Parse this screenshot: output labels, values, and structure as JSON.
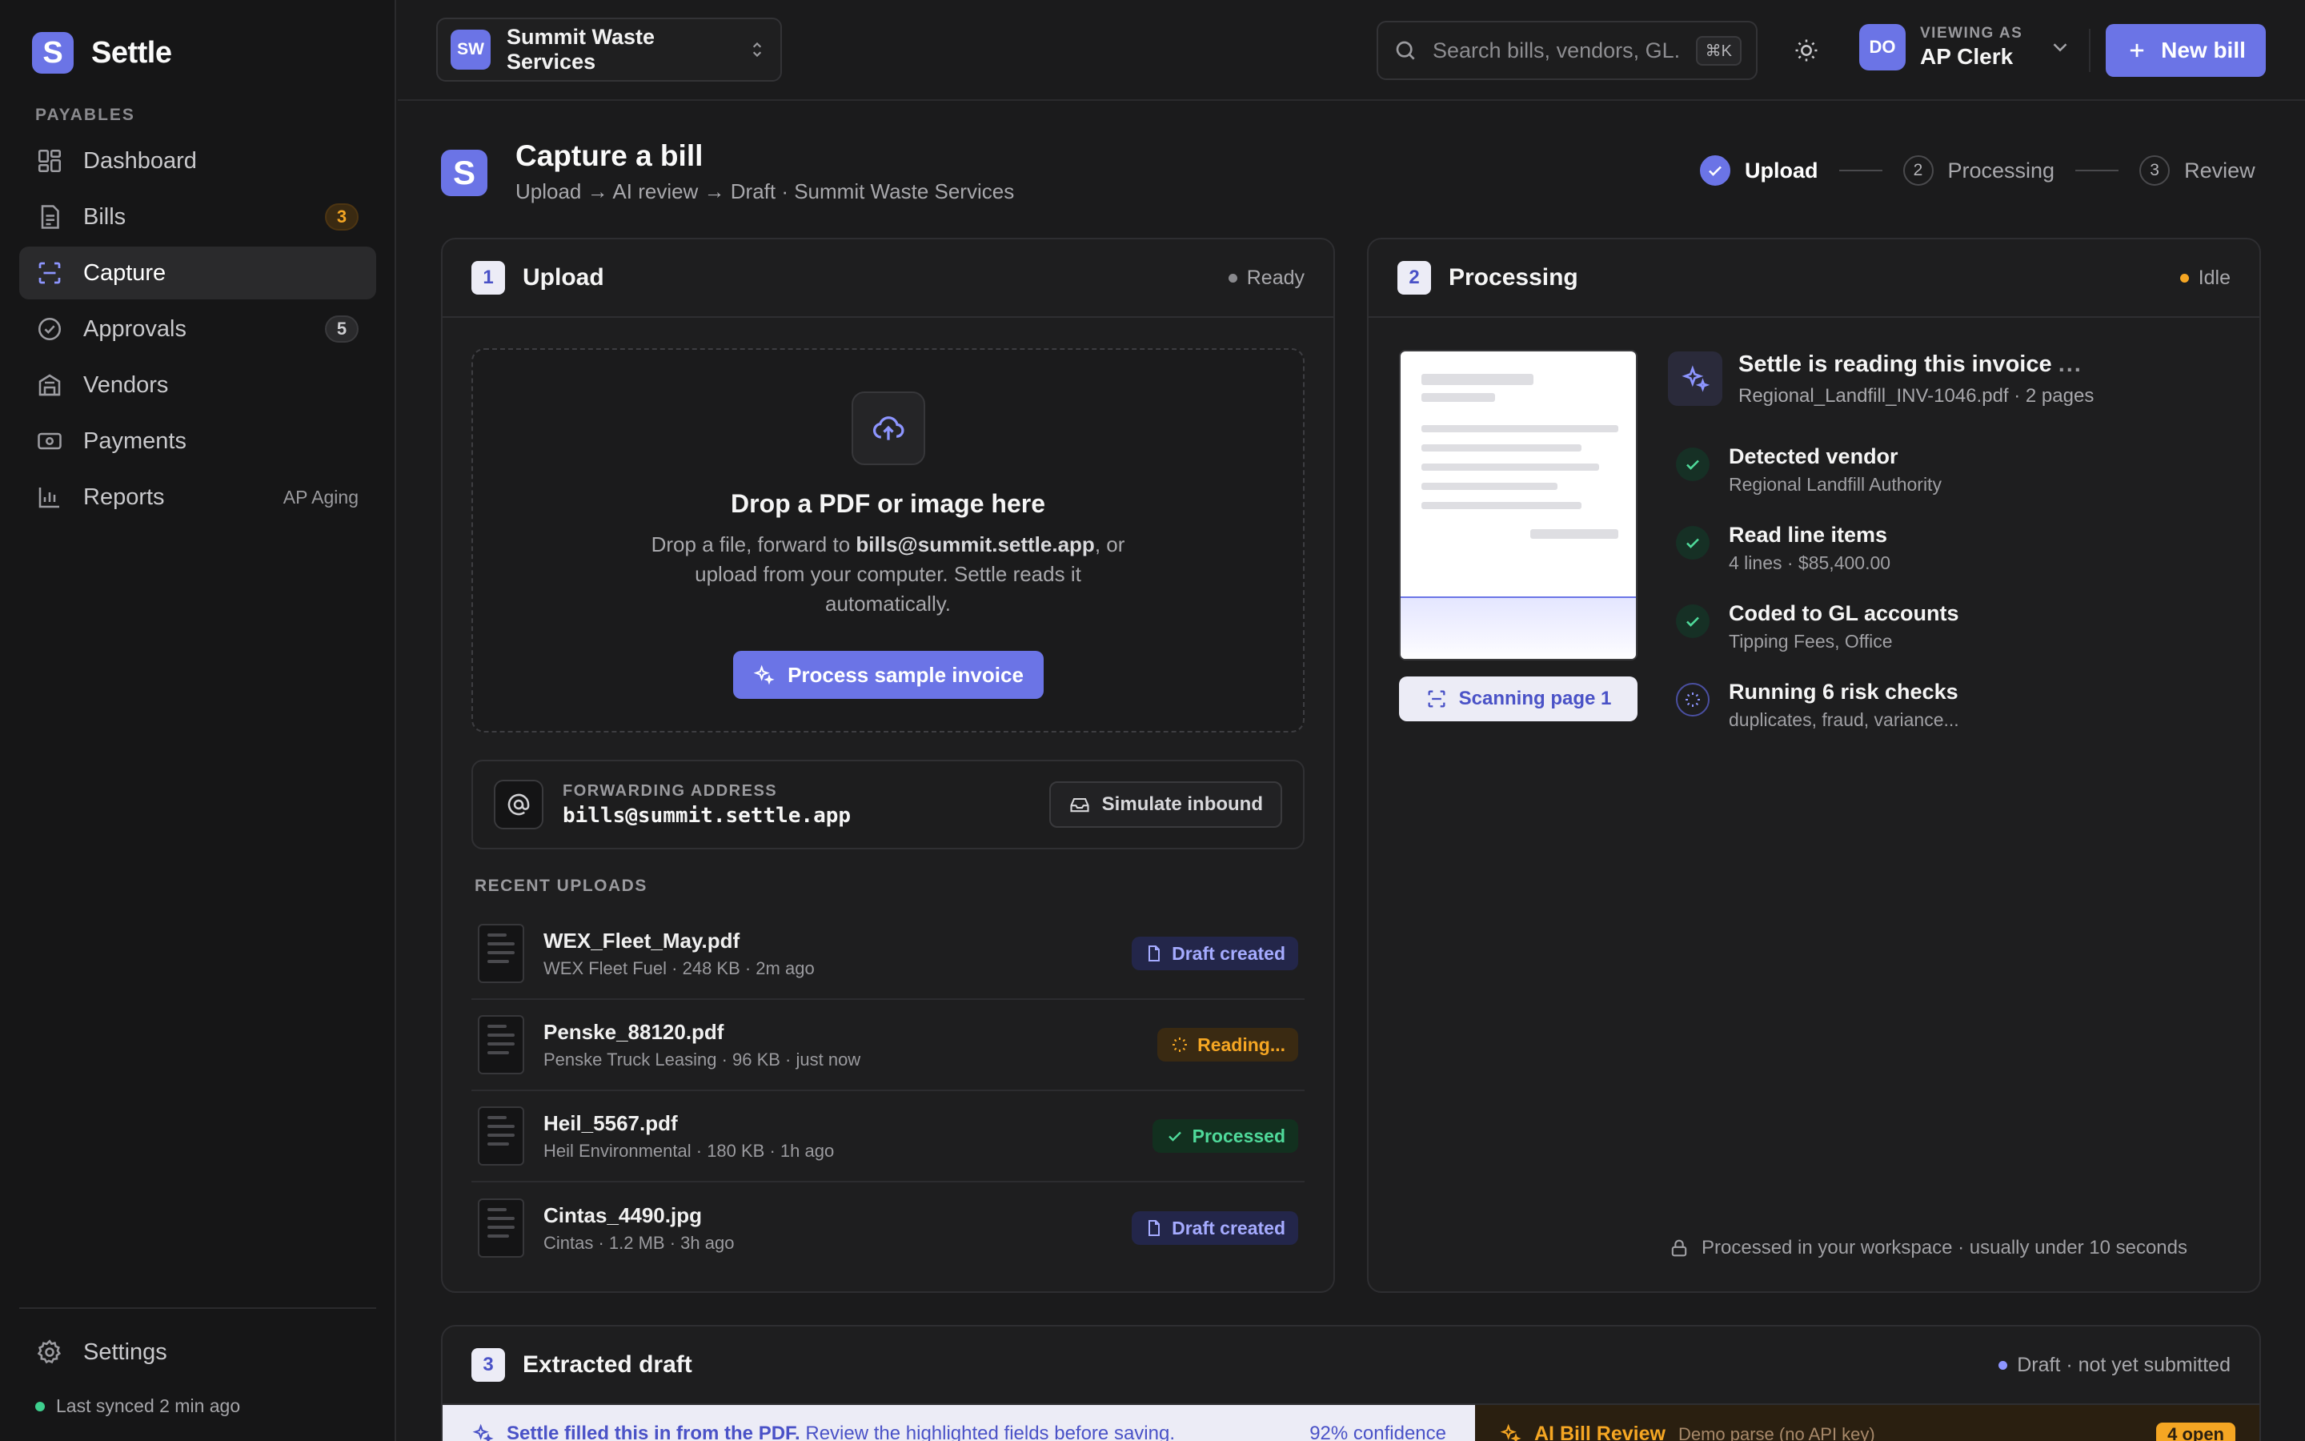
{
  "app": {
    "name": "Settle",
    "logo_letter": "S"
  },
  "sidebar": {
    "section": "PAYABLES",
    "items": [
      {
        "label": "Dashboard",
        "icon": "dashboard-icon"
      },
      {
        "label": "Bills",
        "icon": "bills-icon",
        "count": "3"
      },
      {
        "label": "Capture",
        "icon": "capture-icon",
        "active": true
      },
      {
        "label": "Approvals",
        "icon": "approvals-icon",
        "count": "5"
      },
      {
        "label": "Vendors",
        "icon": "vendors-icon"
      },
      {
        "label": "Payments",
        "icon": "payments-icon"
      },
      {
        "label": "Reports",
        "icon": "reports-icon",
        "hint": "AP Aging"
      }
    ],
    "settings_label": "Settings",
    "sync_status": "Last synced 2 min ago"
  },
  "topbar": {
    "org_initials": "SW",
    "org_name": "Summit Waste Services",
    "search_placeholder": "Search bills, vendors, GL...",
    "search_shortcut": "⌘K",
    "user_initials": "DO",
    "viewing_as_label": "VIEWING AS",
    "user_role": "AP Clerk",
    "new_bill_label": "New bill"
  },
  "page": {
    "title": "Capture a bill",
    "subtitle": "Upload → AI review → Draft · Summit Waste Services",
    "steps": [
      {
        "num": "1",
        "label": "Upload",
        "done": true
      },
      {
        "num": "2",
        "label": "Processing"
      },
      {
        "num": "3",
        "label": "Review"
      }
    ]
  },
  "upload": {
    "num": "1",
    "title": "Upload",
    "status": "Ready",
    "drop_title": "Drop a PDF or image here",
    "drop_desc_pre": "Drop a file, forward to ",
    "drop_desc_email": "bills@summit.settle.app",
    "drop_desc_post": ", or upload from your computer. Settle reads it automatically.",
    "sample_button": "Process sample invoice",
    "forwarding_label": "FORWARDING ADDRESS",
    "forwarding_address": "bills@summit.settle.app",
    "simulate_button": "Simulate inbound",
    "recent_label": "RECENT UPLOADS",
    "recent": [
      {
        "name": "WEX_Fleet_May.pdf",
        "meta": "WEX Fleet Fuel · 248 KB · 2m ago",
        "status": "Draft created",
        "kind": "draft"
      },
      {
        "name": "Penske_88120.pdf",
        "meta": "Penske Truck Leasing · 96 KB · just now",
        "status": "Reading...",
        "kind": "reading"
      },
      {
        "name": "Heil_5567.pdf",
        "meta": "Heil Environmental · 180 KB · 1h ago",
        "status": "Processed",
        "kind": "processed"
      },
      {
        "name": "Cintas_4490.jpg",
        "meta": "Cintas · 1.2 MB · 3h ago",
        "status": "Draft created",
        "kind": "draft"
      }
    ]
  },
  "processing": {
    "num": "2",
    "title": "Processing",
    "status": "Idle",
    "scan_label": "Scanning page 1",
    "reading_title": "Settle is reading this invoice",
    "reading_dots": "...",
    "reading_file": "Regional_Landfill_INV-1046.pdf · 2 pages",
    "checks": [
      {
        "title": "Detected vendor",
        "sub": "Regional Landfill Authority",
        "state": "ok"
      },
      {
        "title": "Read line items",
        "sub": "4 lines · $85,400.00",
        "state": "ok"
      },
      {
        "title": "Coded to GL accounts",
        "sub": "Tipping Fees, Office",
        "state": "ok"
      },
      {
        "title": "Running 6 risk checks",
        "sub": "duplicates, fraud, variance...",
        "state": "running"
      }
    ],
    "footer": "Processed in your workspace · usually under 10 seconds"
  },
  "draft": {
    "num": "3",
    "title": "Extracted draft",
    "status": "Draft · not yet submitted",
    "banner_bold": "Settle filled this in from the PDF.",
    "banner_rest": " Review the highlighted fields before saving.",
    "confidence": "92% confidence",
    "ai_title": "AI Bill Review",
    "ai_sub": "Demo parse (no API key)",
    "ai_open": "4 open"
  },
  "colors": {
    "accent": "#6b74e6",
    "success": "#4fd99a",
    "warning": "#f5a623",
    "background": "#1b1b1c"
  }
}
